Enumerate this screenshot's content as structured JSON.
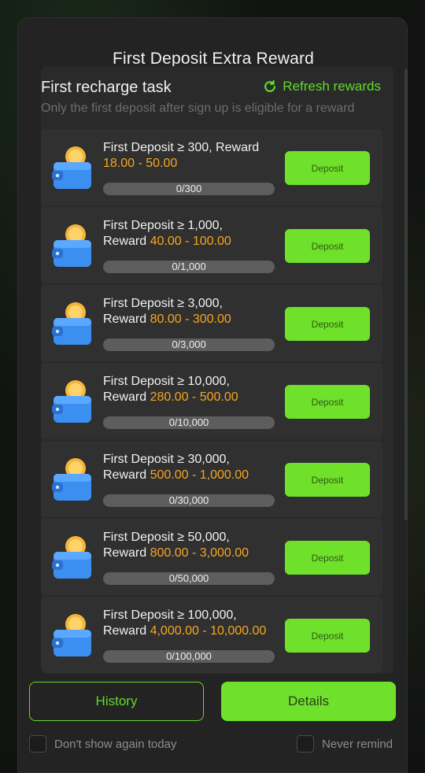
{
  "dialog": {
    "title": "First Deposit Extra Reward"
  },
  "task_panel": {
    "title": "First recharge task",
    "refresh_label": "Refresh rewards",
    "subtitle": "Only the first deposit after sign up is eligible for a reward",
    "deposit_label": "Deposit",
    "tasks": [
      {
        "line1": "First Deposit ≥ 300, Reward",
        "reward_prefix": "",
        "reward_range": "18.00 - 50.00",
        "progress_text": "0/300",
        "progress": 0
      },
      {
        "line1": "First Deposit ≥ 1,000,",
        "reward_prefix": "Reward ",
        "reward_range": "40.00 - 100.00",
        "progress_text": "0/1,000",
        "progress": 0
      },
      {
        "line1": "First Deposit ≥ 3,000,",
        "reward_prefix": "Reward ",
        "reward_range": "80.00 - 300.00",
        "progress_text": "0/3,000",
        "progress": 0
      },
      {
        "line1": "First Deposit ≥ 10,000,",
        "reward_prefix": "Reward ",
        "reward_range": "280.00 - 500.00",
        "progress_text": "0/10,000",
        "progress": 0
      },
      {
        "line1": "First Deposit ≥ 30,000,",
        "reward_prefix": "Reward ",
        "reward_range": "500.00 - 1,000.00",
        "progress_text": "0/30,000",
        "progress": 0
      },
      {
        "line1": "First Deposit ≥ 50,000,",
        "reward_prefix": "Reward ",
        "reward_range": "800.00 - 3,000.00",
        "progress_text": "0/50,000",
        "progress": 0
      },
      {
        "line1": "First Deposit ≥ 100,000,",
        "reward_prefix": "Reward ",
        "reward_range": "4,000.00 - 10,000.00",
        "progress_text": "0/100,000",
        "progress": 0
      }
    ]
  },
  "footer": {
    "history_label": "History",
    "details_label": "Details",
    "dont_show_today_label": "Don't show again today",
    "never_remind_label": "Never remind"
  },
  "colors": {
    "accent_green": "#6fe12a",
    "reward_orange": "#f5a623"
  },
  "icons": {
    "refresh": "refresh-icon",
    "wallet": "wallet-coin-icon"
  }
}
